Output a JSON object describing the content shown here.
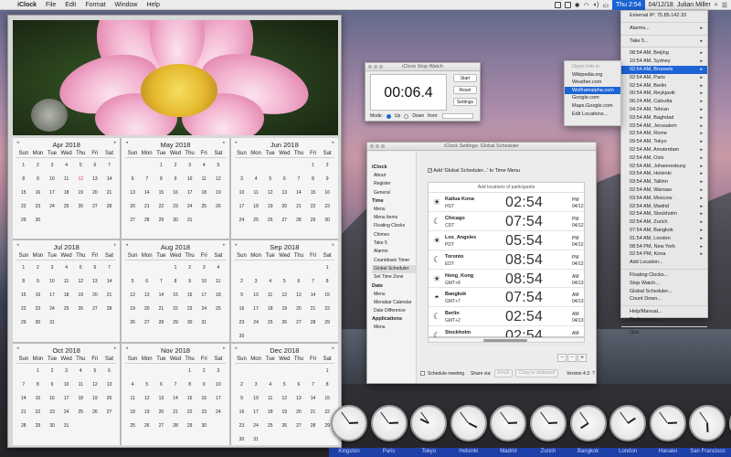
{
  "menubar": {
    "apple": "",
    "app": "iClock",
    "items": [
      "File",
      "Edit",
      "Format",
      "Window",
      "Help"
    ],
    "clock": "Thu 2:54",
    "date": "04/12/18",
    "user": "Julian Miller"
  },
  "calendar": {
    "weekdays": [
      "Sun",
      "Mon",
      "Tue",
      "Wed",
      "Thu",
      "Fri",
      "Sat"
    ],
    "months": [
      {
        "name": "Apr 2018",
        "start": 0,
        "days": 30,
        "today": 12
      },
      {
        "name": "May 2018",
        "start": 2,
        "days": 31
      },
      {
        "name": "Jun 2018",
        "start": 5,
        "days": 30
      },
      {
        "name": "Jul 2018",
        "start": 0,
        "days": 31
      },
      {
        "name": "Aug 2018",
        "start": 3,
        "days": 31
      },
      {
        "name": "Sep 2018",
        "start": 6,
        "days": 30
      },
      {
        "name": "Oct 2018",
        "start": 1,
        "days": 31
      },
      {
        "name": "Nov 2018",
        "start": 4,
        "days": 30
      },
      {
        "name": "Dec 2018",
        "start": 6,
        "days": 31
      }
    ]
  },
  "stopwatch": {
    "title": "iClock Stop Watch",
    "time": "00:06.4",
    "start": "Start",
    "reset": "Reset",
    "settings": "Settings",
    "mode_label": "Mode:",
    "up": "Up",
    "down": "Down",
    "from": "from:"
  },
  "scheduler": {
    "title": "iClock Settings: Global Scheduler",
    "add_label": "Add 'Global Scheduler...' to Time Menu",
    "list_header": "Add locations of participants",
    "sidebar": [
      {
        "h": "iClock"
      },
      {
        "i": "About"
      },
      {
        "i": "Register"
      },
      {
        "i": "General"
      },
      {
        "h": "Time"
      },
      {
        "i": "Menu"
      },
      {
        "i": "Menu Items"
      },
      {
        "i": "Floating Clocks"
      },
      {
        "i": "Chimes"
      },
      {
        "i": "Take 5"
      },
      {
        "i": "Alarms"
      },
      {
        "i": "Countdown Timer"
      },
      {
        "i": "Global Scheduler",
        "sel": true
      },
      {
        "i": "Set Time Zone"
      },
      {
        "h": "Date"
      },
      {
        "i": "Menu"
      },
      {
        "i": "Menubar Calendar"
      },
      {
        "i": "Date Difference"
      },
      {
        "h": "Applications"
      },
      {
        "i": "Menu"
      }
    ],
    "rows": [
      {
        "city": "Kailua Kona",
        "tz": "HST",
        "time": "02:54",
        "ampm": "PM",
        "date": "04/12",
        "icon": "sun"
      },
      {
        "city": "Chicago",
        "tz": "CDT",
        "time": "07:54",
        "ampm": "PM",
        "date": "04/12",
        "icon": "moon"
      },
      {
        "city": "Los_Angeles",
        "tz": "PDT",
        "time": "05:54",
        "ampm": "PM",
        "date": "04/12",
        "icon": "sun"
      },
      {
        "city": "Toronto",
        "tz": "EDT",
        "time": "08:54",
        "ampm": "PM",
        "date": "04/12",
        "icon": "moon"
      },
      {
        "city": "Hong_Kong",
        "tz": "GMT+8",
        "time": "08:54",
        "ampm": "AM",
        "date": "04/13",
        "icon": "sun"
      },
      {
        "city": "Bangkok",
        "tz": "GMT+7",
        "time": "07:54",
        "ampm": "AM",
        "date": "04/13",
        "icon": "sunrise"
      },
      {
        "city": "Berlin",
        "tz": "GMT+2",
        "time": "02:54",
        "ampm": "AM",
        "date": "04/13",
        "icon": "moon"
      },
      {
        "city": "Stockholm",
        "tz": "GMT+2",
        "time": "02:54",
        "ampm": "AM",
        "date": "04/13",
        "icon": "moon"
      }
    ],
    "schedule": "Schedule meeting",
    "share": "Share via:",
    "email": "Email",
    "copy": "Copy to clipboard",
    "version": "Version 4.3",
    "plus": "+",
    "minus": "−"
  },
  "menu": {
    "items": [
      {
        "t": "External IP: 75.85.142.33"
      },
      {
        "d": 1
      },
      {
        "t": "Alarms...",
        "a": 1
      },
      {
        "d": 1
      },
      {
        "t": "Take 5...",
        "a": 1
      },
      {
        "d": 1
      },
      {
        "t": "08:54 AM, Beijing",
        "a": 1
      },
      {
        "t": "10:54 AM, Sydney",
        "a": 1
      },
      {
        "t": "02:54 AM, Brussels",
        "a": 1,
        "sel": 1
      },
      {
        "t": "02:54 AM, Paris",
        "a": 1
      },
      {
        "t": "02:54 AM, Berlin",
        "a": 1
      },
      {
        "t": "00:54 AM, Reykjavik",
        "a": 1
      },
      {
        "t": "06:24 AM, Calcutta",
        "a": 1
      },
      {
        "t": "04:24 AM, Tehran",
        "a": 1
      },
      {
        "t": "03:54 AM, Baghdad",
        "a": 1
      },
      {
        "t": "03:54 AM, Jerusalem",
        "a": 1
      },
      {
        "t": "02:54 AM, Rome",
        "a": 1
      },
      {
        "t": "09:54 AM, Tokyo",
        "a": 1
      },
      {
        "t": "02:54 AM, Amsterdam",
        "a": 1
      },
      {
        "t": "02:54 AM, Oslo",
        "a": 1
      },
      {
        "t": "02:54 AM, Johannesburg",
        "a": 1
      },
      {
        "t": "03:54 AM, Helsinki",
        "a": 1
      },
      {
        "t": "03:54 AM, Tallinn",
        "a": 1
      },
      {
        "t": "02:54 AM, Warsaw",
        "a": 1
      },
      {
        "t": "03:54 AM, Moscow",
        "a": 1
      },
      {
        "t": "02:54 AM, Madrid",
        "a": 1
      },
      {
        "t": "02:54 AM, Stockholm",
        "a": 1
      },
      {
        "t": "02:54 AM, Zurich",
        "a": 1
      },
      {
        "t": "07:54 AM, Bangkok",
        "a": 1
      },
      {
        "t": "01:54 AM, London",
        "a": 1
      },
      {
        "t": "08:54 PM, New York",
        "a": 1
      },
      {
        "t": "02:54 PM, Kona",
        "a": 1
      },
      {
        "t": "Add Location..."
      },
      {
        "d": 1
      },
      {
        "t": "Floating Clocks..."
      },
      {
        "t": "Stop Watch..."
      },
      {
        "t": "Global Scheduler..."
      },
      {
        "t": "Count Down..."
      },
      {
        "d": 1
      },
      {
        "t": "Help/Manual..."
      },
      {
        "t": "Preferences..."
      },
      {
        "d": 1
      },
      {
        "t": "Quit"
      }
    ]
  },
  "submenu": {
    "items": [
      {
        "t": "Open Info in",
        "dis": 1
      },
      {
        "d": 1
      },
      {
        "t": "Wikipedia.org"
      },
      {
        "t": "Weather.com"
      },
      {
        "t": "Wolframalpha.com",
        "sel": 1
      },
      {
        "t": "Google.com"
      },
      {
        "t": "Maps.Google.com"
      },
      {
        "d": 1
      },
      {
        "t": "Edit Locations..."
      }
    ]
  },
  "clocks": [
    {
      "city": "Kingston",
      "h": 2,
      "m": 54
    },
    {
      "city": "Paris",
      "h": 2,
      "m": 54
    },
    {
      "city": "Tokyo",
      "h": 9,
      "m": 54
    },
    {
      "city": "Helsinki",
      "h": 3,
      "m": 54
    },
    {
      "city": "Madrid",
      "h": 2,
      "m": 54
    },
    {
      "city": "Zurich",
      "h": 2,
      "m": 54
    },
    {
      "city": "Bangkok",
      "h": 7,
      "m": 54
    },
    {
      "city": "London",
      "h": 1,
      "m": 54
    },
    {
      "city": "Hanalei",
      "h": 2,
      "m": 54
    },
    {
      "city": "San Francisco",
      "h": 5,
      "m": 54
    },
    {
      "city": "Kona",
      "h": 2,
      "m": 54
    }
  ]
}
